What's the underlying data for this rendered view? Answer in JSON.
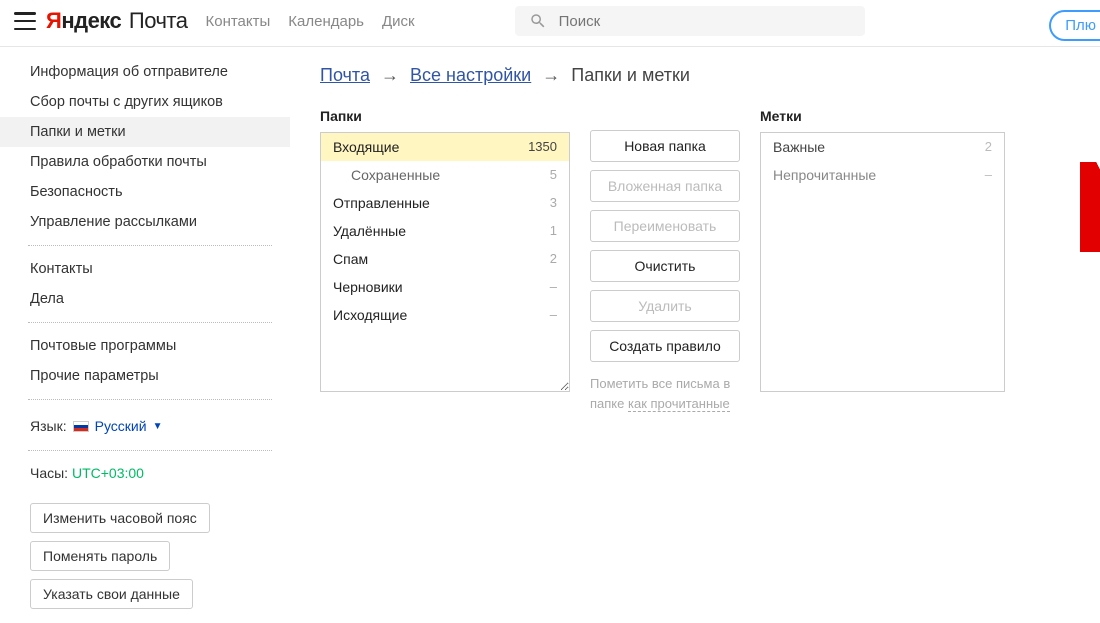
{
  "header": {
    "logo_ya_y": "Я",
    "logo_ya_rest": "ндекс",
    "logo_mail": "Почта",
    "nav": [
      "Контакты",
      "Календарь",
      "Диск"
    ],
    "search_placeholder": "Поиск",
    "plus": "Плю"
  },
  "sidebar": {
    "groups": [
      [
        "Информация об отправителе",
        "Сбор почты с других ящиков",
        "Папки и метки",
        "Правила обработки почты",
        "Безопасность",
        "Управление рассылками"
      ],
      [
        "Контакты",
        "Дела"
      ],
      [
        "Почтовые программы",
        "Прочие параметры"
      ]
    ],
    "active": "Папки и метки",
    "lang_label": "Язык:",
    "lang_value": "Русский",
    "clock_label": "Часы:",
    "clock_value": "UTC+03:00",
    "buttons": [
      "Изменить часовой пояс",
      "Поменять пароль",
      "Указать свои данные"
    ]
  },
  "breadcrumb": {
    "mail": "Почта",
    "all_settings": "Все настройки",
    "current": "Папки и метки"
  },
  "folders": {
    "title": "Папки",
    "items": [
      {
        "name": "Входящие",
        "count": "1350",
        "selected": true
      },
      {
        "name": "Сохраненные",
        "count": "5",
        "child": true
      },
      {
        "name": "Отправленные",
        "count": "3"
      },
      {
        "name": "Удалённые",
        "count": "1"
      },
      {
        "name": "Спам",
        "count": "2"
      },
      {
        "name": "Черновики",
        "count": "–"
      },
      {
        "name": "Исходящие",
        "count": "–"
      }
    ]
  },
  "actions": {
    "buttons": [
      {
        "label": "Новая папка",
        "enabled": true
      },
      {
        "label": "Вложенная папка",
        "enabled": false
      },
      {
        "label": "Переименовать",
        "enabled": false
      },
      {
        "label": "Очистить",
        "enabled": true
      },
      {
        "label": "Удалить",
        "enabled": false
      },
      {
        "label": "Создать правило",
        "enabled": true
      }
    ],
    "mark_prefix": "Пометить все письма в папке ",
    "mark_link": "как прочитанные"
  },
  "labels": {
    "title": "Метки",
    "items": [
      {
        "name": "Важные",
        "count": "2"
      },
      {
        "name": "Непрочитанные",
        "count": "–"
      }
    ]
  }
}
